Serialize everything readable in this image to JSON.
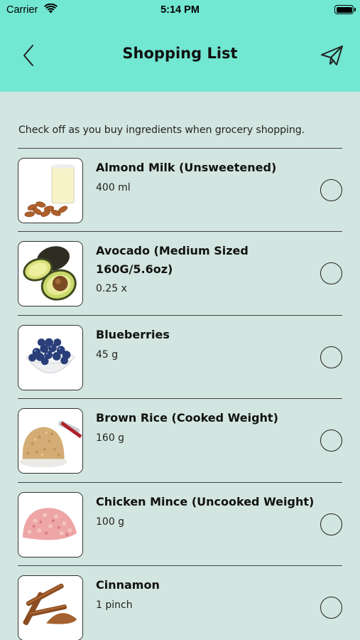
{
  "status_bar": {
    "carrier": "Carrier",
    "time": "5:14 PM"
  },
  "header": {
    "title": "Shopping List",
    "back_icon": "chevron-left-icon",
    "share_icon": "paper-plane-icon"
  },
  "intro": "Check off as you buy ingredients when grocery shopping.",
  "colors": {
    "header_bg": "#72e7d2",
    "page_bg": "#d3e5e0"
  },
  "items": [
    {
      "name": "Almond Milk (Unsweetened)",
      "quantity": "400 ml",
      "checked": false,
      "image": "almond-milk-image"
    },
    {
      "name": "Avocado (Medium Sized 160G/5.6oz)",
      "quantity": "0.25 x",
      "checked": false,
      "image": "avocado-image"
    },
    {
      "name": "Blueberries",
      "quantity": "45 g",
      "checked": false,
      "image": "blueberries-image"
    },
    {
      "name": "Brown Rice (Cooked Weight)",
      "quantity": "160 g",
      "checked": false,
      "image": "brown-rice-image"
    },
    {
      "name": "Chicken Mince (Uncooked Weight)",
      "quantity": "100 g",
      "checked": false,
      "image": "chicken-mince-image"
    },
    {
      "name": "Cinnamon",
      "quantity": "1 pinch",
      "checked": false,
      "image": "cinnamon-image"
    }
  ]
}
